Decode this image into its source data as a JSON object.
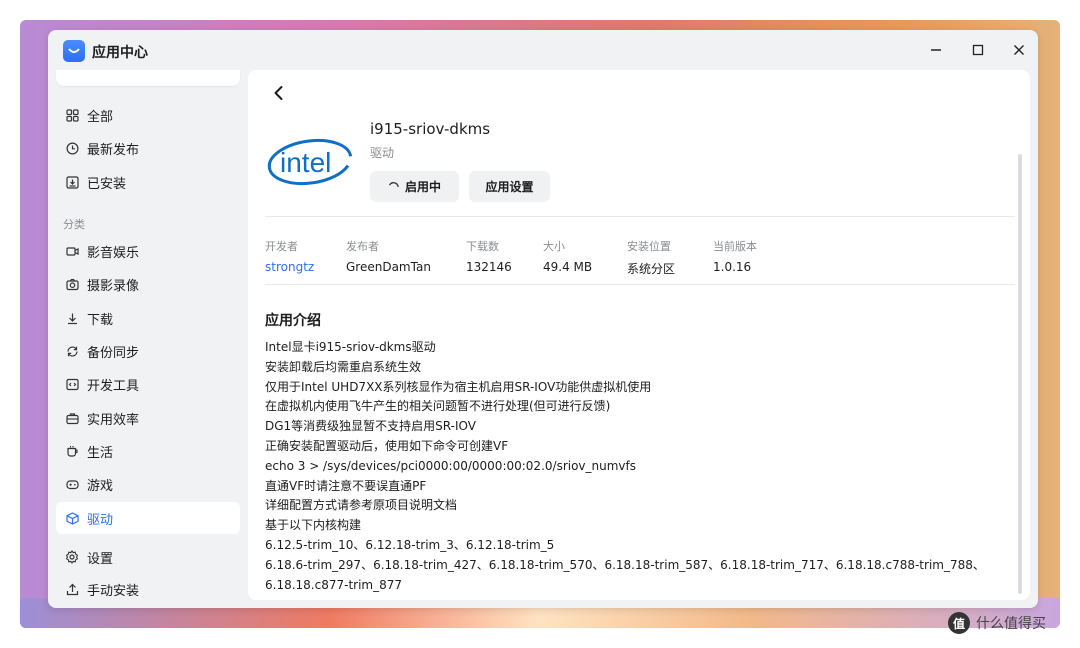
{
  "window": {
    "title": "应用中心",
    "minimize": "—",
    "maximize": "☐",
    "close": "✕"
  },
  "sidebar": {
    "items": [
      {
        "label": "全部",
        "icon": "grid-icon"
      },
      {
        "label": "最新发布",
        "icon": "clock-icon"
      },
      {
        "label": "已安装",
        "icon": "installed-icon"
      }
    ],
    "section_label": "分类",
    "categories": [
      {
        "label": "影音娱乐",
        "icon": "video-icon"
      },
      {
        "label": "摄影录像",
        "icon": "camera-icon"
      },
      {
        "label": "下载",
        "icon": "download-icon"
      },
      {
        "label": "备份同步",
        "icon": "sync-icon"
      },
      {
        "label": "开发工具",
        "icon": "code-icon"
      },
      {
        "label": "实用效率",
        "icon": "briefcase-icon"
      },
      {
        "label": "生活",
        "icon": "cup-icon"
      },
      {
        "label": "游戏",
        "icon": "gamepad-icon"
      },
      {
        "label": "驱动",
        "icon": "cube-icon",
        "active": true
      }
    ],
    "bottom": [
      {
        "label": "设置",
        "icon": "gear-icon"
      },
      {
        "label": "手动安装",
        "icon": "upload-icon"
      }
    ]
  },
  "app": {
    "name": "i915-sriov-dkms",
    "category": "驱动",
    "logo_text": "intel",
    "start_button": "启用中",
    "settings_button": "应用设置",
    "meta": [
      {
        "label": "开发者",
        "value": "strongtz",
        "link": true
      },
      {
        "label": "发布者",
        "value": "GreenDamTan"
      },
      {
        "label": "下载数",
        "value": "132146"
      },
      {
        "label": "大小",
        "value": "49.4 MB"
      },
      {
        "label": "安装位置",
        "value": "系统分区"
      },
      {
        "label": "当前版本",
        "value": "1.0.16"
      }
    ],
    "intro_title": "应用介绍",
    "intro_lines": [
      "Intel显卡i915-sriov-dkms驱动",
      "安装卸载后均需重启系统生效",
      "仅用于Intel UHD7XX系列核显作为宿主机启用SR-IOV功能供虚拟机使用",
      "在虚拟机内使用飞牛产生的相关问题暂不进行处理(但可进行反馈)",
      "DG1等消费级独显暂不支持启用SR-IOV",
      "正确安装配置驱动后，使用如下命令可创建VF",
      "echo 3 > /sys/devices/pci0000:00/0000:00:02.0/sriov_numvfs",
      "直通VF时请注意不要误直通PF",
      "详细配置方式请参考原项目说明文档",
      "基于以下内核构建",
      "6.12.5-trim_10、6.12.18-trim_3、6.12.18-trim_5",
      "6.18.6-trim_297、6.18.18-trim_427、6.18.18-trim_570、6.18.18-trim_587、6.18.18-trim_717、6.18.18.c788-trim_788、6.18.18.c877-trim_877"
    ]
  },
  "watermark": {
    "icon_text": "值",
    "label": "什么值得买"
  },
  "colors": {
    "accent": "#2c6ff2",
    "intel_blue": "#0f6fc6"
  }
}
